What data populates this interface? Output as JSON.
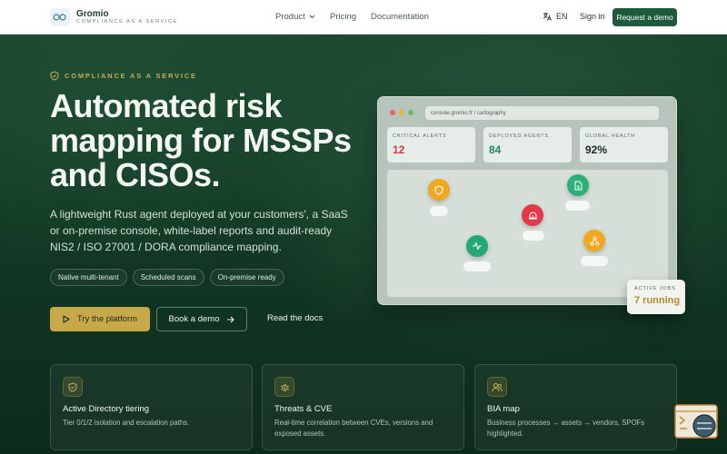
{
  "header": {
    "brand_name": "Gromio",
    "brand_tagline": "COMPLIANCE AS A SERVICE",
    "nav": [
      {
        "label": "Product",
        "icon": "chevron-down-icon"
      },
      {
        "label": "Pricing"
      },
      {
        "label": "Documentation"
      }
    ],
    "language": "EN",
    "sign_in": "Sign in",
    "request_demo": "Request a demo"
  },
  "hero": {
    "eyebrow": "COMPLIANCE AS A SERVICE",
    "title": "Automated risk mapping for MSSPs and CISOs.",
    "description": "A lightweight Rust agent deployed at your customers', a SaaS or on-premise console, white-label reports and audit-ready NIS2 / ISO 27001 / DORA compliance mapping.",
    "chips": [
      "Native multi-tenant",
      "Scheduled scans",
      "On-premise ready"
    ],
    "cta_primary": "Try the platform",
    "cta_secondary": "Book a demo",
    "cta_link": "Read the docs"
  },
  "console": {
    "url": "console.gromio.fr / cartography",
    "stats": [
      {
        "label": "CRITICAL ALERTS",
        "value": "12",
        "color": "#d33a3a"
      },
      {
        "label": "DEPLOYED AGENTS",
        "value": "84",
        "color": "#1f8c5a"
      },
      {
        "label": "GLOBAL HEALTH",
        "value": "92%",
        "color": "#1b2a22"
      }
    ],
    "nodes": [
      {
        "icon": "shield-icon",
        "color": "#f0a821"
      },
      {
        "icon": "document-icon",
        "color": "#2bb07a"
      },
      {
        "icon": "alert-icon",
        "color": "#e2384a"
      },
      {
        "icon": "activity-icon",
        "color": "#23a874"
      },
      {
        "icon": "network-icon",
        "color": "#f0a821"
      }
    ],
    "active_jobs_label": "ACTIVE JOBS",
    "active_jobs_value": "7 running"
  },
  "features": [
    {
      "icon": "shield-icon",
      "title": "Active Directory tiering",
      "description": "Tier 0/1/2 isolation and escalation paths."
    },
    {
      "icon": "bug-icon",
      "title": "Threats & CVE",
      "description": "Real-time correlation between CVEs, versions and exposed assets."
    },
    {
      "icon": "users-icon",
      "title": "BIA map",
      "description": "Business processes → assets → vendors, SPOFs highlighted."
    }
  ],
  "colors": {
    "accent_gold": "#c8a94a",
    "brand_green": "#1c5a3b"
  }
}
